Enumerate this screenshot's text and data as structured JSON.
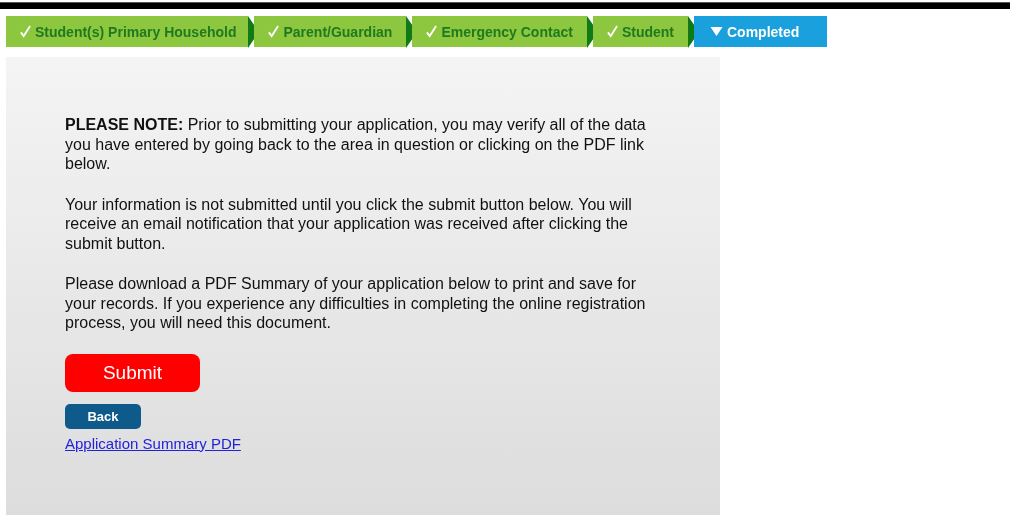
{
  "steps": [
    {
      "label": "Student(s) Primary Household",
      "selected": false
    },
    {
      "label": "Parent/Guardian",
      "selected": false
    },
    {
      "label": "Emergency Contact",
      "selected": false
    },
    {
      "label": "Student",
      "selected": false
    },
    {
      "label": "Completed",
      "selected": true
    }
  ],
  "notes": [
    "**PLEASE NOTE:** Prior to submitting your application, you may verify all of the data you have entered by going back to the area in question or clicking on the PDF link below.",
    "Your information is not submitted until you click the submit button below. You will receive an email notification that your application was received after clicking the submit button.",
    "Please download a PDF Summary of your application below to print and save for your records. If you experience any difficulties in completing the online registration process, you will need this document."
  ],
  "submit_button": "Submit",
  "back_button": "Back",
  "summary_link": "Application Summary PDF"
}
